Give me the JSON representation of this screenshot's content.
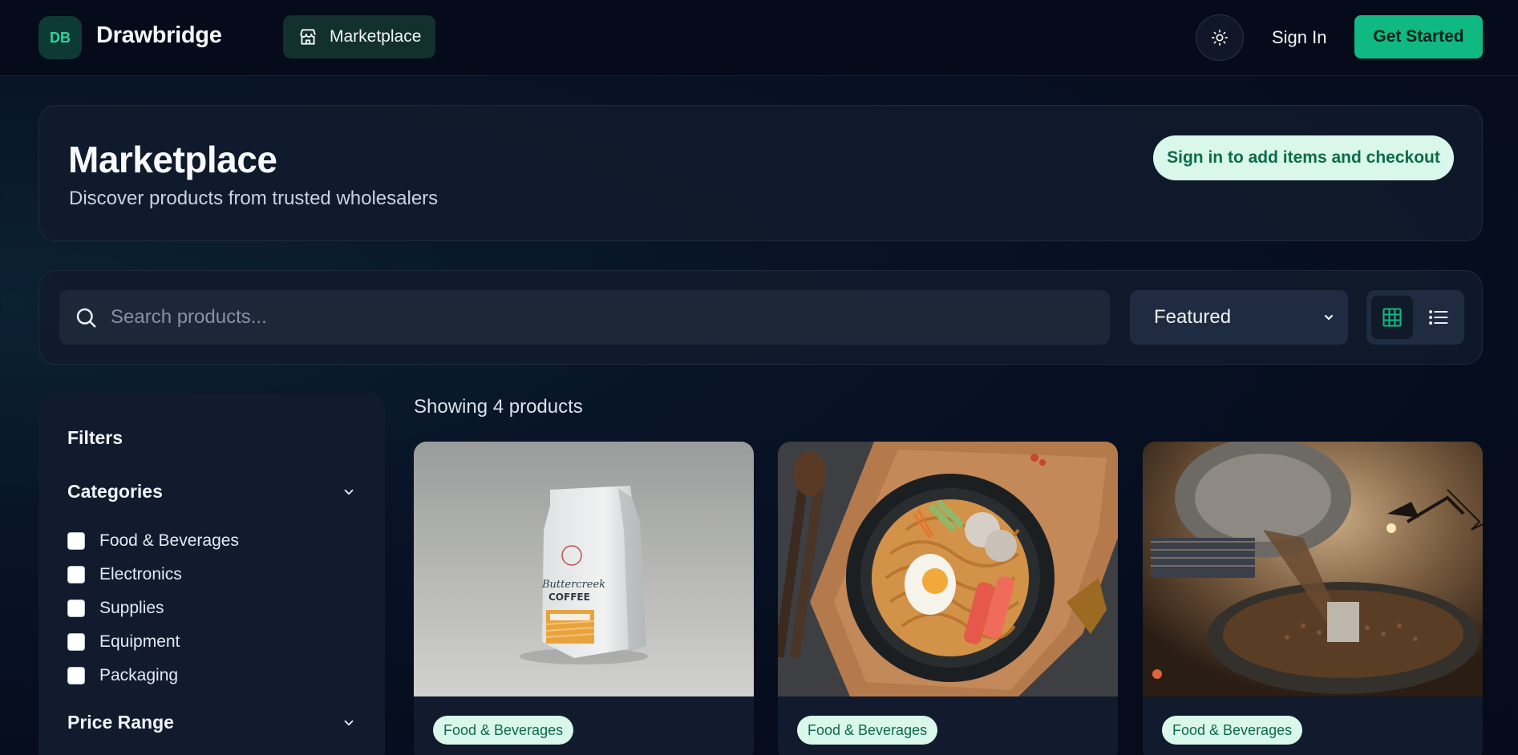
{
  "navbar": {
    "logo_initials": "DB",
    "brand": "Drawbridge",
    "marketplace_label": "Marketplace",
    "signin_label": "Sign In",
    "get_started_label": "Get Started"
  },
  "hero": {
    "title": "Marketplace",
    "subtitle": "Discover products from trusted wholesalers",
    "cta_label": "Sign in to add items and checkout"
  },
  "search": {
    "placeholder": "Search products...",
    "sort_selected": "Featured",
    "view_mode": "grid"
  },
  "filters": {
    "title": "Filters",
    "categories_label": "Categories",
    "categories": [
      {
        "label": "Food & Beverages",
        "checked": false
      },
      {
        "label": "Electronics",
        "checked": false
      },
      {
        "label": "Supplies",
        "checked": false
      },
      {
        "label": "Equipment",
        "checked": false
      },
      {
        "label": "Packaging",
        "checked": false
      }
    ],
    "price_range_label": "Price Range"
  },
  "products": {
    "showing_text": "Showing 4 products",
    "items": [
      {
        "category": "Food & Beverages",
        "image": "coffee-bag"
      },
      {
        "category": "Food & Beverages",
        "image": "noodle-bowl"
      },
      {
        "category": "Food & Beverages",
        "image": "coffee-roaster"
      }
    ]
  },
  "colors": {
    "accent": "#10b981",
    "background": "#050b1a",
    "panel": "#111b2d",
    "badge_bg": "#d9f7ea",
    "badge_text": "#0c6b4b"
  }
}
